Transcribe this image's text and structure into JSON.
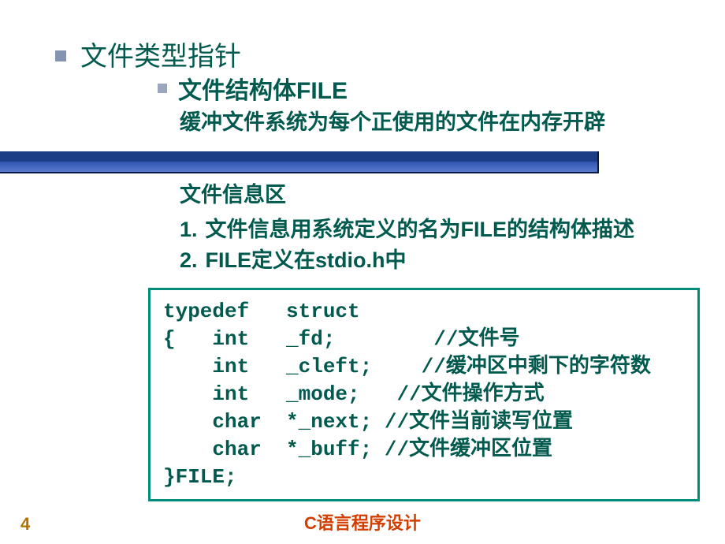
{
  "main": {
    "heading": "文件类型指针",
    "sub_heading": "文件结构体FILE",
    "para1": "缓冲文件系统为每个正使用的文件在内存开辟",
    "para2": "文件信息区",
    "list": {
      "n1": "1.",
      "t1": "文件信息用系统定义的名为FILE的结构体描述",
      "n2": "2.",
      "t2": "FILE定义在stdio.h中"
    }
  },
  "code": {
    "l1": "typedef   struct",
    "l2": "{   int   _fd;        //文件号",
    "l3": "    int   _cleft;    //缓冲区中剩下的字符数",
    "l4": "    int   _mode;   //文件操作方式",
    "l5": "    char  *_next; //文件当前读写位置",
    "l6": "    char  *_buff; //文件缓冲区位置",
    "l7": "}FILE;"
  },
  "footer": {
    "page": "4",
    "title": "C语言程序设计"
  }
}
